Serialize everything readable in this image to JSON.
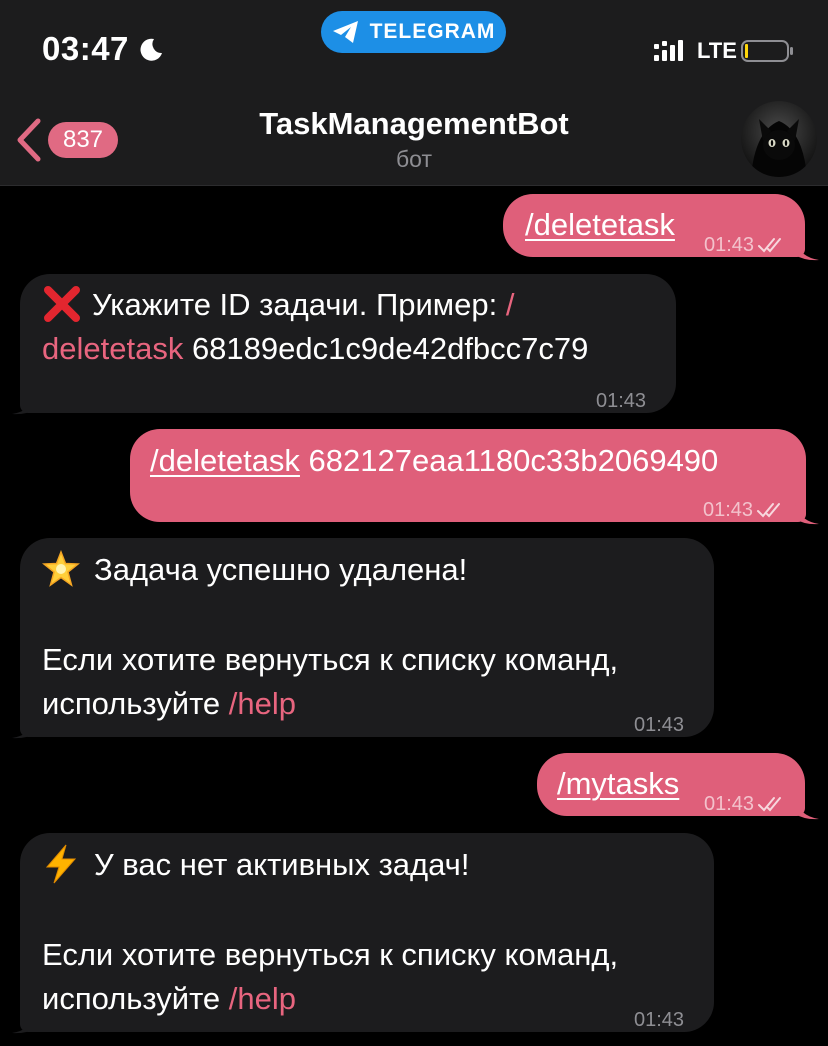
{
  "status_bar": {
    "time": "03:47",
    "network": "LTE"
  },
  "top_pill": {
    "label": "TELEGRAM",
    "color": "#1d8fe6"
  },
  "header": {
    "back_badge": "837",
    "title": "TaskManagementBot",
    "subtitle": "бот"
  },
  "colors": {
    "outgoing_bubble": "#df5f7a",
    "incoming_bubble": "#1c1c1e",
    "command_link": "#e8657f",
    "background": "#000000"
  },
  "messages": [
    {
      "direction": "outgoing",
      "command": "/deletetask",
      "time": "01:43",
      "status": "read"
    },
    {
      "direction": "incoming",
      "icon": "cross-mark-icon",
      "text_before": "Укажите ID задачи. Пример: ",
      "command_part1": "/",
      "command_part2": "deletetask",
      "text_after": " 68189edc1c9de42dfbcc7c79",
      "time": "01:43"
    },
    {
      "direction": "outgoing",
      "command": "/deletetask",
      "text_after": " 682127eaa1180c33b2069490",
      "time": "01:43",
      "status": "read"
    },
    {
      "direction": "incoming",
      "icon": "glowing-star-icon",
      "headline": "Задача успешно удалена!",
      "line1": "Если хотите вернуться к списку команд,",
      "line2_prefix": "используйте ",
      "command": "/help",
      "time": "01:43"
    },
    {
      "direction": "outgoing",
      "command": "/mytasks",
      "time": "01:43",
      "status": "read"
    },
    {
      "direction": "incoming",
      "icon": "lightning-icon",
      "headline": "У вас нет активных задач!",
      "line1": "Если хотите вернуться к списку команд,",
      "line2_prefix": "используйте ",
      "command": "/help",
      "time": "01:43"
    }
  ]
}
